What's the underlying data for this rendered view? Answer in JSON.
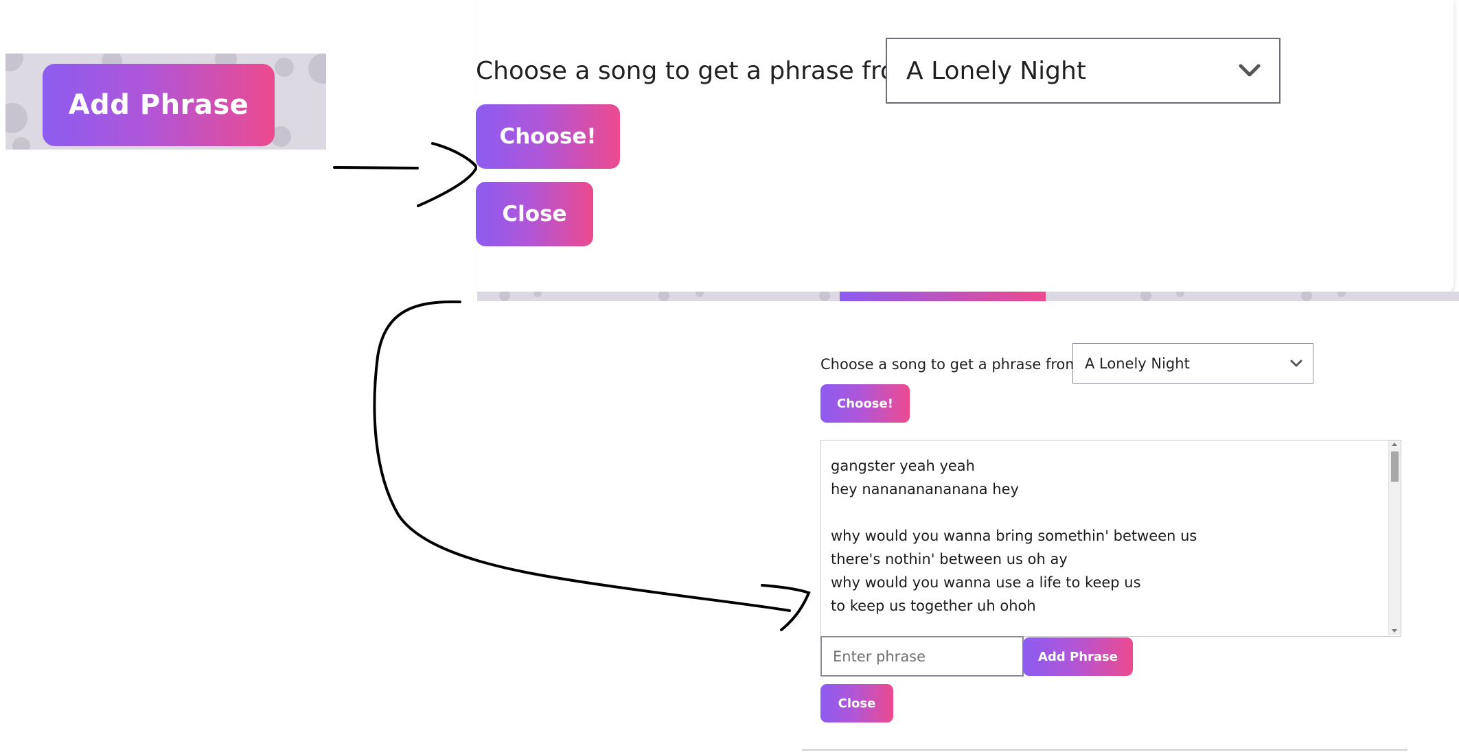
{
  "thumbnail": {
    "button_label": "Add Phrase"
  },
  "popup_large": {
    "label": "Choose a song to get a phrase from:",
    "selected_song": "A Lonely Night",
    "choose_label": "Choose!",
    "close_label": "Close"
  },
  "popup_small": {
    "label": "Choose a song to get a phrase from:",
    "selected_song": "A Lonely Night",
    "choose_label": "Choose!",
    "lyrics": "gangster yeah yeah\nhey nanananananana hey\n\nwhy would you wanna bring somethin' between us\nthere's nothin' between us oh ay\nwhy would you wanna use a life to keep us\nto keep us together uh ohoh",
    "phrase_placeholder": "Enter phrase",
    "add_label": "Add Phrase",
    "close_label": "Close"
  },
  "colors": {
    "gradient_start": "#8c5cf0",
    "gradient_end": "#ec4a8e",
    "background_pattern": "#dcd9e2"
  },
  "icons": {
    "select_chevron": "chevron-down-icon",
    "flow_arrow": "hand-drawn-arrow-icon"
  }
}
